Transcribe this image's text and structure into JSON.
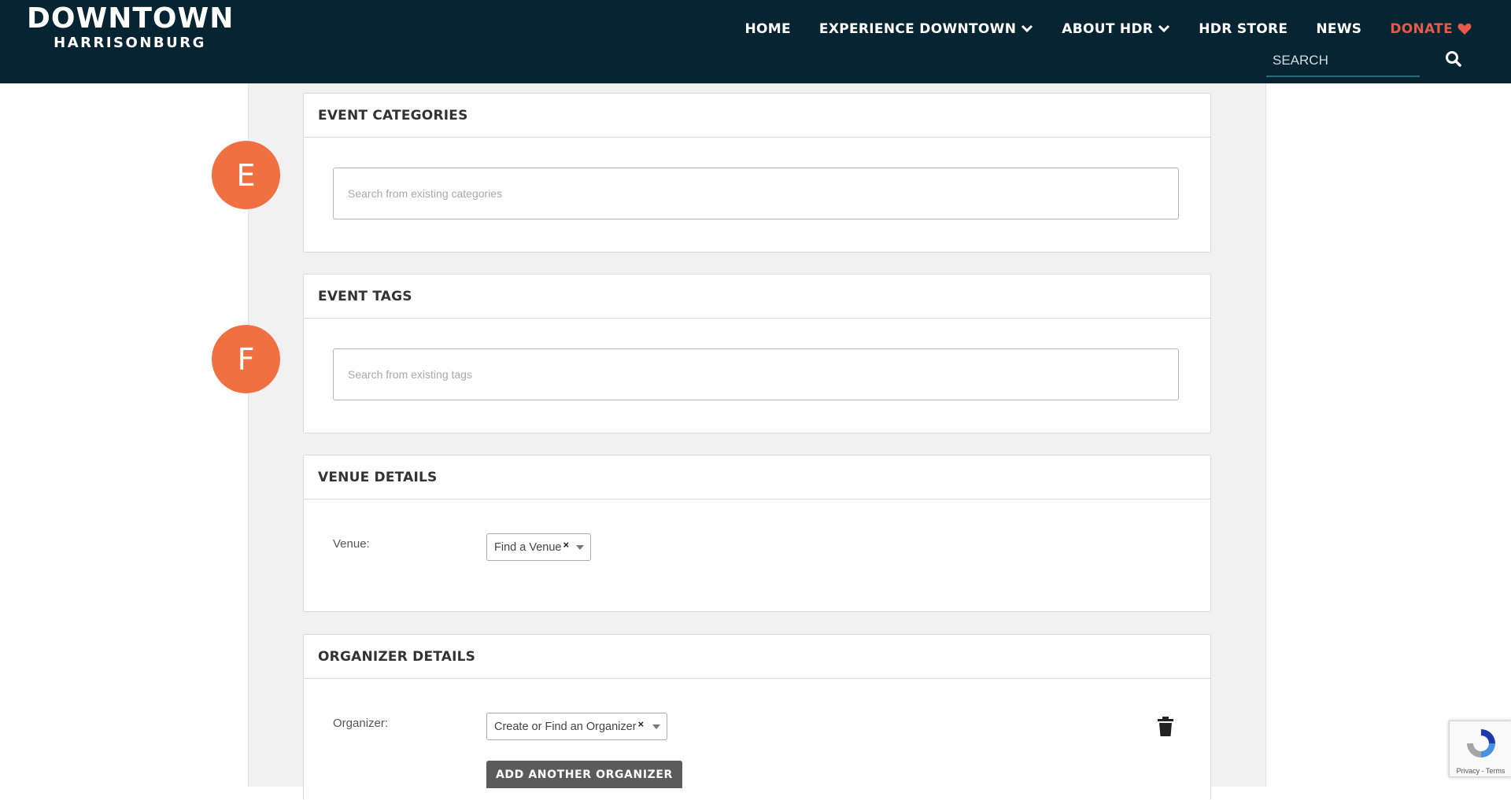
{
  "header": {
    "logo": {
      "main": "DOWNTOWN",
      "sub": "HARRISONBURG"
    },
    "nav": {
      "home": "HOME",
      "experience": "EXPERIENCE DOWNTOWN",
      "about": "ABOUT HDR",
      "store": "HDR STORE",
      "news": "NEWS",
      "donate": "DONATE"
    },
    "search": {
      "placeholder": "SEARCH"
    },
    "colors": {
      "background": "#062432",
      "donate": "#e85a48"
    }
  },
  "markers": {
    "e": "E",
    "f": "F",
    "color": "#f07042"
  },
  "categories": {
    "title": "EVENT CATEGORIES",
    "placeholder": "Search from existing categories"
  },
  "tags": {
    "title": "EVENT TAGS",
    "placeholder": "Search from existing tags"
  },
  "venue": {
    "title": "VENUE DETAILS",
    "label": "Venue:",
    "select_value": "Find a Venue",
    "clear_glyph": "×"
  },
  "organizer": {
    "title": "ORGANIZER DETAILS",
    "label": "Organizer:",
    "select_value": "Create or Find an Organizer",
    "clear_glyph": "×",
    "add_button": "ADD ANOTHER ORGANIZER",
    "delete_icon": "trash-icon"
  },
  "recaptcha": {
    "terms": "Privacy - Terms"
  }
}
